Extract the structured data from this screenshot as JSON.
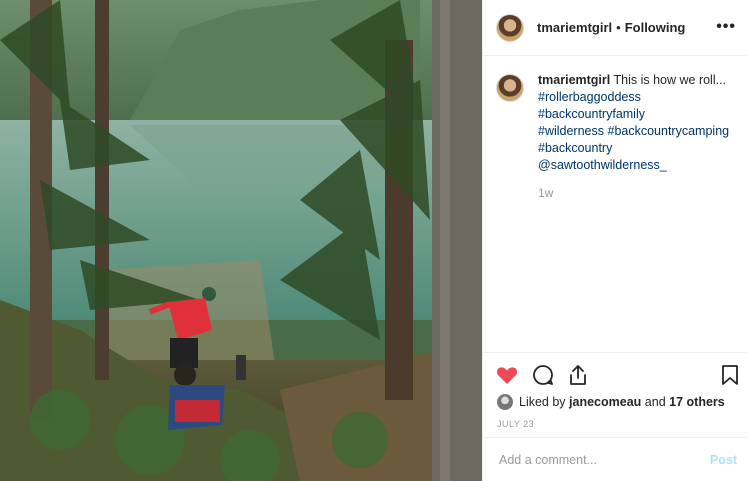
{
  "post": {
    "username": "tmariemtgirl",
    "separator": "•",
    "follow_status": "Following",
    "more_label": "•••",
    "caption_username": "tmariemtgirl",
    "caption_text": "This is how we roll...",
    "hashtags": [
      "#rollerbaggoddess",
      "#backcountryfamily",
      "#wilderness",
      "#backcountrycamping",
      "#backcountry",
      "@sawtoothwilderness_"
    ],
    "time_ago": "1w",
    "liked_by_prefix": "Liked by",
    "liked_by_user": "janecomeau",
    "liked_by_and": "and",
    "liked_by_others": "17 others",
    "date": "JULY 23",
    "comment_placeholder": "Add a comment...",
    "post_button": "Post"
  },
  "icons": {
    "like": "heart-icon",
    "comment": "comment-icon",
    "share": "share-icon",
    "save": "bookmark-icon",
    "more": "more-options-icon"
  },
  "colors": {
    "like_red": "#ed4956",
    "link_blue": "#003569",
    "post_disabled": "#b2dffc",
    "muted": "#999999"
  }
}
